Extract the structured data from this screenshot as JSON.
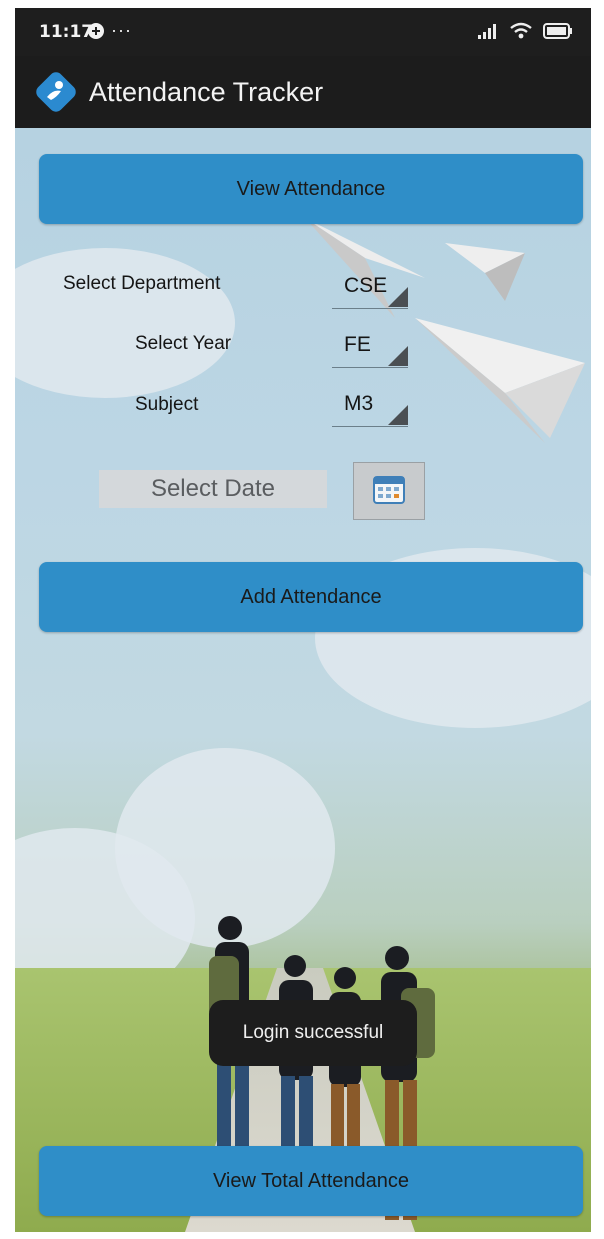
{
  "status_bar": {
    "time": "11:17",
    "notification_icons": [
      "sync-icon",
      "more-dots-icon"
    ],
    "system_icons": [
      "signal-icon",
      "wifi-icon",
      "battery-icon"
    ]
  },
  "app_bar": {
    "title": "Attendance Tracker",
    "logo_icon": "app-logo-icon"
  },
  "main": {
    "view_attendance_label": "View Attendance",
    "department": {
      "label": "Select Department",
      "value": "CSE"
    },
    "year": {
      "label": "Select Year",
      "value": "FE"
    },
    "subject": {
      "label": "Subject",
      "value": "M3"
    },
    "date_placeholder": "Select Date",
    "calendar_icon": "calendar-icon",
    "add_attendance_label": "Add Attendance",
    "view_total_label": "View Total Attendance"
  },
  "toast": {
    "message": "Login successful"
  },
  "colors": {
    "button": "#2f8ec8",
    "app_bar": "#1c1c1c",
    "toast": "#1d1d1d"
  }
}
